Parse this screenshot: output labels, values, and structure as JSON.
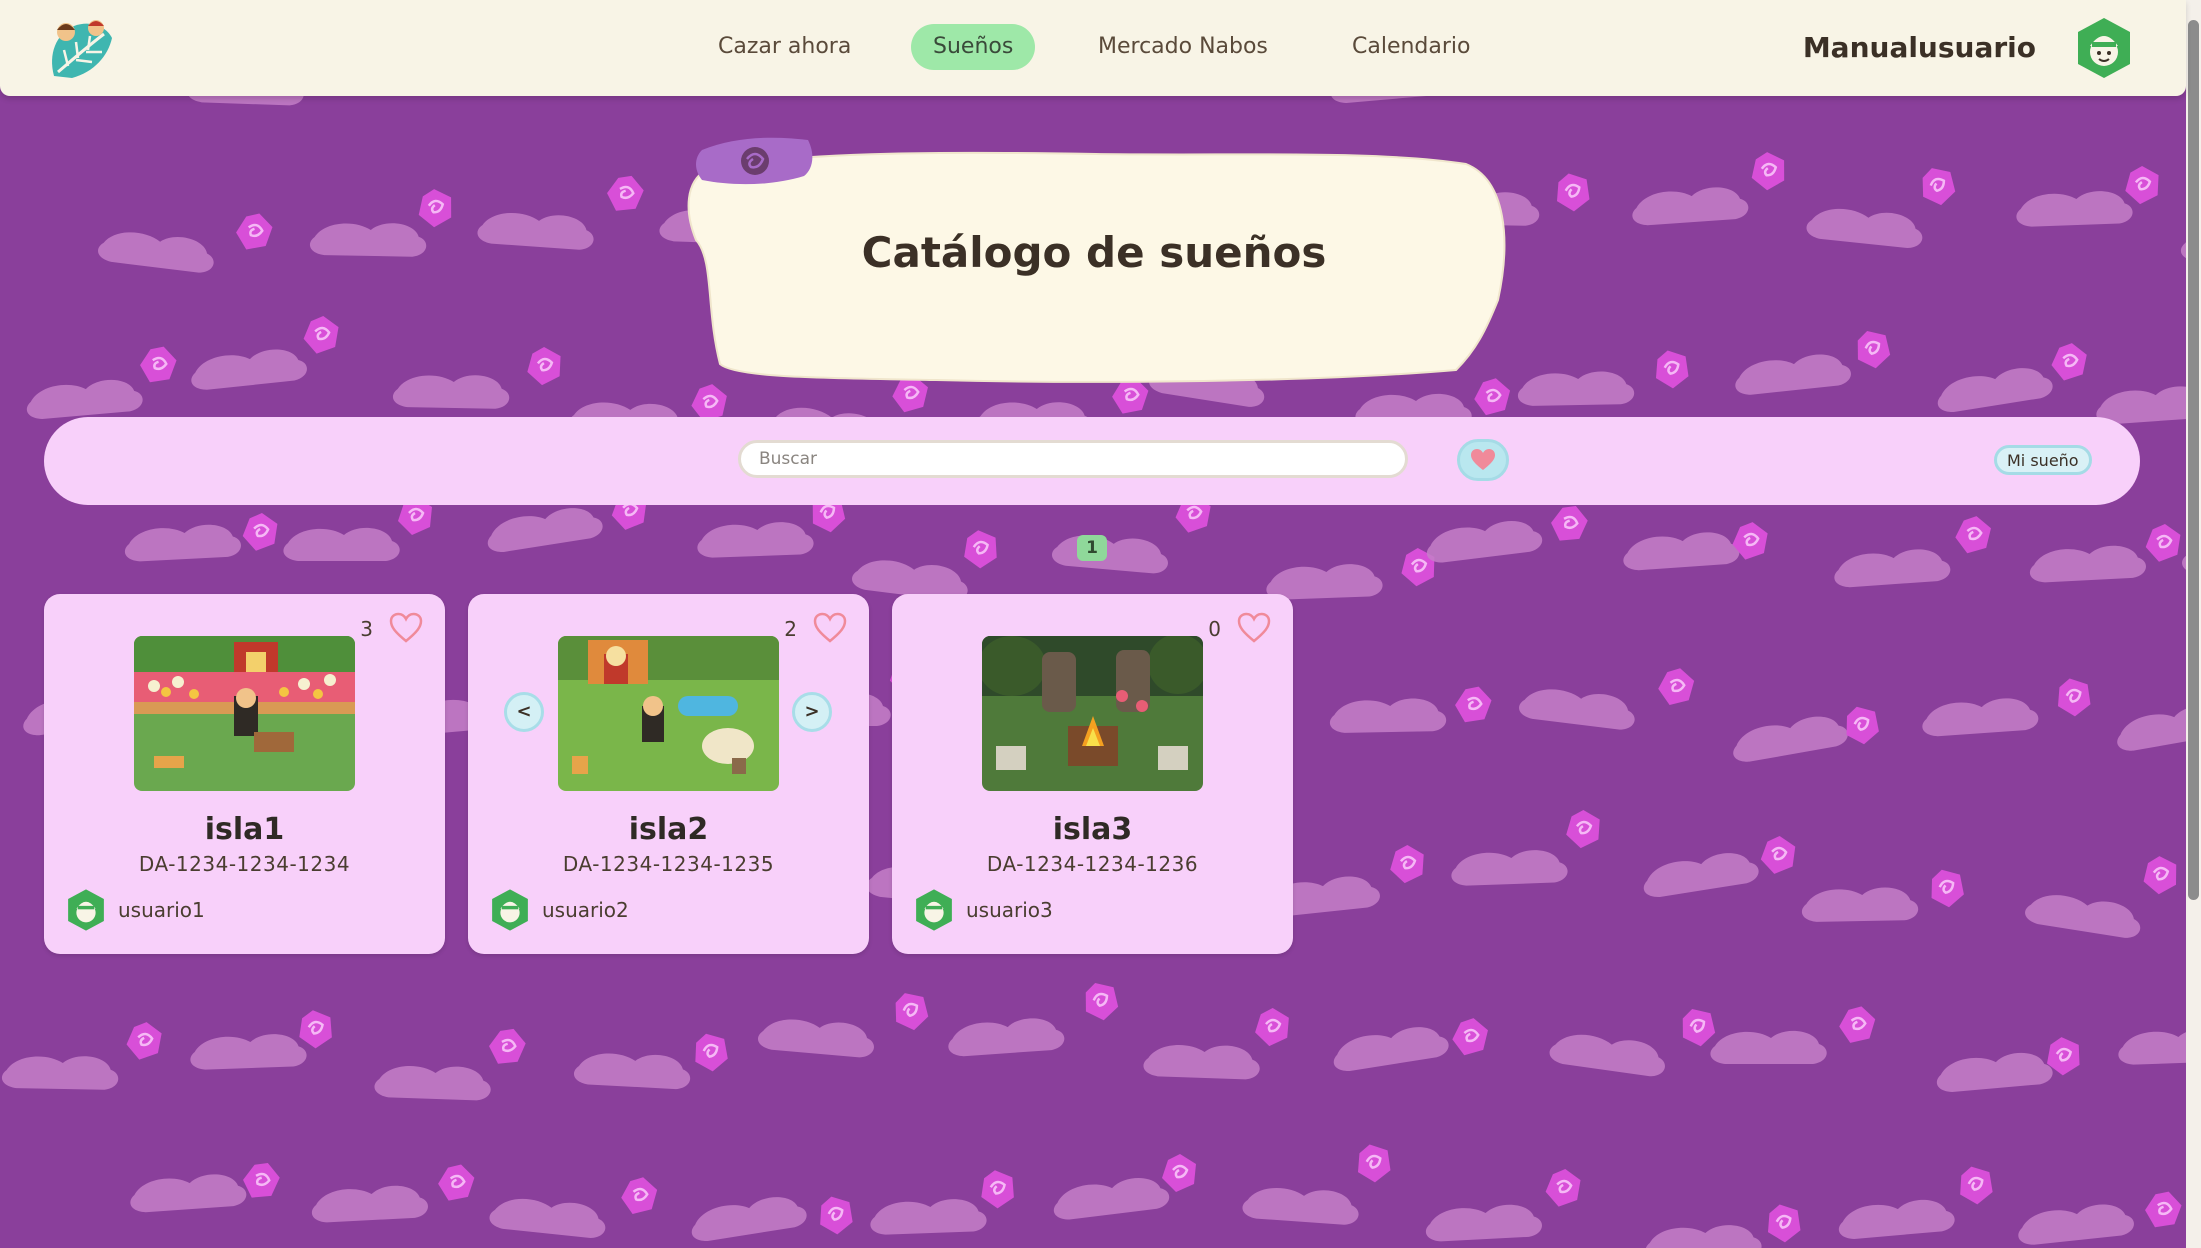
{
  "nav": {
    "logo_icon": "leaf-logo-icon",
    "items": [
      {
        "label": "Cazar ahora",
        "active": false
      },
      {
        "label": "Sueños",
        "active": true
      },
      {
        "label": "Mercado Nabos",
        "active": false
      },
      {
        "label": "Calendario",
        "active": false
      }
    ],
    "username": "Manualusuario",
    "avatar_icon": "user-avatar-icon"
  },
  "header": {
    "title": "Catálogo de sueños",
    "tag_icon": "rose-icon"
  },
  "search": {
    "placeholder": "Buscar",
    "value": "",
    "fav_filter_icon": "heart-icon",
    "my_dream_label": "Mi sueño"
  },
  "pagination": {
    "current_page": "1"
  },
  "cards": [
    {
      "name": "isla1",
      "code": "DA-1234-1234-1234",
      "user": "usuario1",
      "likes": "3",
      "has_arrows": false
    },
    {
      "name": "isla2",
      "code": "DA-1234-1234-1235",
      "user": "usuario2",
      "likes": "2",
      "has_arrows": true,
      "prev_label": "<",
      "next_label": ">"
    },
    {
      "name": "isla3",
      "code": "DA-1234-1234-1236",
      "user": "usuario3",
      "likes": "0",
      "has_arrows": false
    }
  ],
  "colors": {
    "background": "#8a3f9b",
    "pattern_cloud": "#c47fc8",
    "pattern_rose": "#d84fd8",
    "card": "#f8d0fa",
    "nav_bg": "#f8f4e6",
    "nav_active": "#9ee8a8",
    "title_card": "#fdf8e6",
    "heart": "#f08a9a"
  }
}
